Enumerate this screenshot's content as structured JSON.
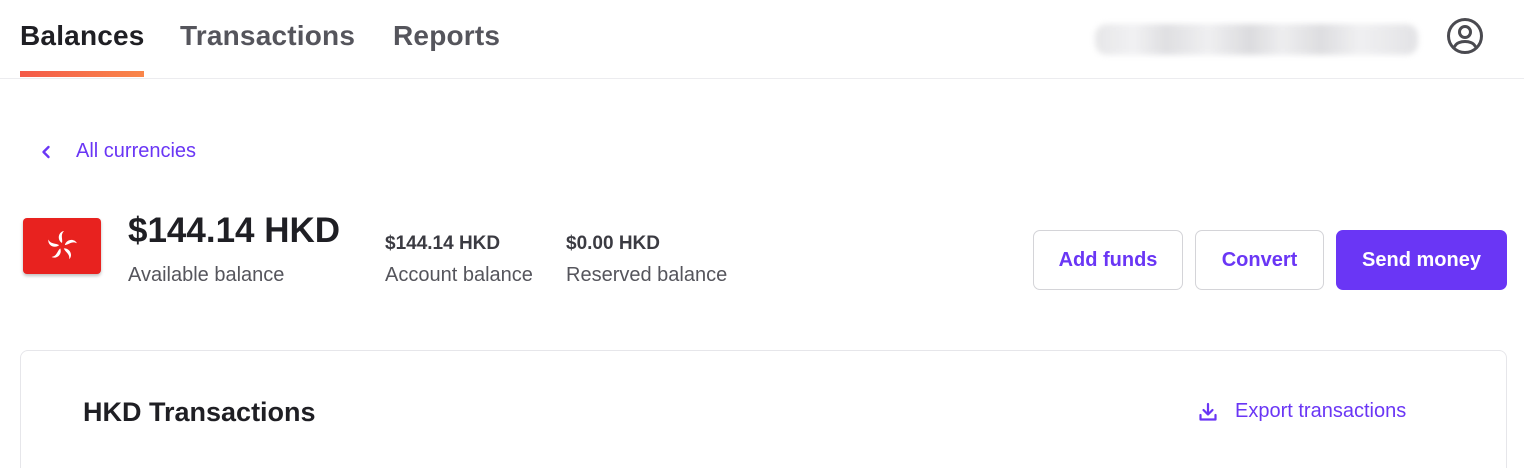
{
  "nav": {
    "tabs": [
      {
        "label": "Balances",
        "active": true
      },
      {
        "label": "Transactions",
        "active": false
      },
      {
        "label": "Reports",
        "active": false
      }
    ],
    "account_name_redacted": true,
    "profile_icon": "user-circle-icon"
  },
  "back_link": {
    "label": "All currencies",
    "icon": "chevron-left-icon"
  },
  "currency": {
    "flag_icon": "hong-kong-flag-icon",
    "flag_color": "#e8221f"
  },
  "balances": {
    "available": {
      "amount": "$144.14 HKD",
      "label": "Available balance"
    },
    "account": {
      "amount": "$144.14 HKD",
      "label": "Account balance"
    },
    "reserved": {
      "amount": "$0.00 HKD",
      "label": "Reserved balance"
    }
  },
  "actions": {
    "add_funds": "Add funds",
    "convert": "Convert",
    "send_money": "Send money"
  },
  "transactions": {
    "title": "HKD Transactions",
    "export_label": "Export transactions",
    "export_icon": "download-icon"
  },
  "colors": {
    "accent": "#6a36f5",
    "tab_underline_start": "#f45a49",
    "tab_underline_end": "#f9864a"
  }
}
